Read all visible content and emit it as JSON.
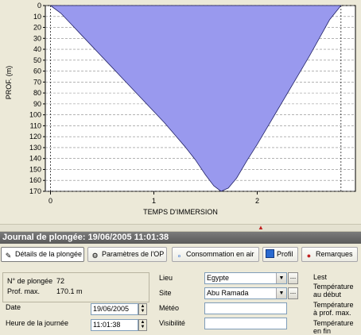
{
  "chart_data": {
    "type": "area",
    "xlabel": "TEMPS D'IMMERSION",
    "ylabel": "PROF. (m)",
    "xlim": [
      -0.05,
      2.95
    ],
    "ylim": [
      170,
      0
    ],
    "x_ticks": [
      "0",
      "1",
      "2"
    ],
    "y_ticks": [
      "0",
      "10",
      "20",
      "30",
      "40",
      "50",
      "60",
      "70",
      "80",
      "90",
      "100",
      "110",
      "120",
      "130",
      "140",
      "150",
      "160",
      "170"
    ],
    "grid": true,
    "fill_color": "#9999ee",
    "x": [
      0.0,
      0.1,
      0.2,
      0.3,
      0.4,
      0.5,
      0.6,
      0.7,
      0.8,
      0.9,
      1.0,
      1.1,
      1.2,
      1.3,
      1.4,
      1.5,
      1.58,
      1.65,
      1.72,
      1.8,
      1.9,
      2.0,
      2.1,
      2.2,
      2.3,
      2.4,
      2.5,
      2.6,
      2.7,
      2.81
    ],
    "y": [
      0,
      7,
      17,
      27,
      37,
      47,
      57,
      67,
      77,
      87,
      97,
      107,
      118,
      129,
      141,
      155,
      165,
      170,
      167,
      158,
      142,
      127,
      111,
      95,
      79,
      63,
      47,
      30,
      13,
      0
    ]
  },
  "titlebar": {
    "text": "Journal de plongée: 19/06/2005 11:01:38"
  },
  "tabs": [
    {
      "label": "Détails de la plongée",
      "icon": "pencil-icon"
    },
    {
      "label": "Paramètres de l'OP",
      "icon": "gear-icon"
    },
    {
      "label": "Consommation en air",
      "icon": "bubbles-icon"
    },
    {
      "label": "Profil",
      "icon": "profile-chart-icon"
    },
    {
      "label": "Remarques",
      "icon": "pushpin-icon"
    }
  ],
  "info": {
    "dive_no_label": "N° de plongée",
    "dive_no_value": "72",
    "max_depth_label": "Prof. max.",
    "max_depth_value": "170.1 m"
  },
  "form": {
    "date_label": "Date",
    "date_value": "19/06/2005",
    "time_label": "Heure de la journée",
    "time_value": "11:01:38",
    "lieu_label": "Lieu",
    "lieu_value": "Egypte",
    "site_label": "Site",
    "site_value": "Abu Ramada",
    "meteo_label": "Météo",
    "meteo_value": "",
    "visibilite_label": "Visibilité",
    "visibilite_value": "",
    "lest_label": "Lest",
    "temp_surface_label_1": "Température",
    "temp_surface_label_2": "au début",
    "temp_max_label_1": "Température",
    "temp_max_label_2": "à prof. max.",
    "temp_fin_label_1": "Température",
    "temp_fin_label_2": "en fin"
  },
  "colors": {
    "area": "#9999ee",
    "titlebar": "#6a6a6a",
    "background": "#ece9d8"
  }
}
